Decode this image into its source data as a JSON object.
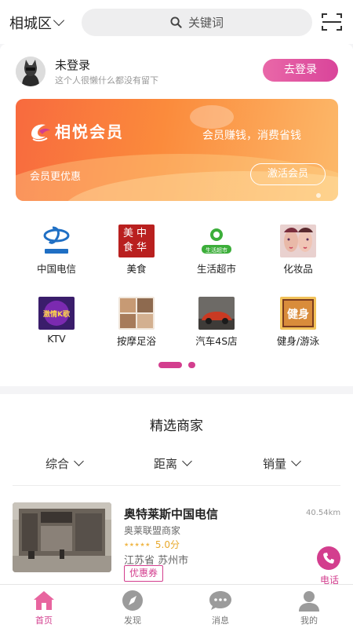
{
  "header": {
    "city": "相城区",
    "search_placeholder": "关键词"
  },
  "user": {
    "name": "未登录",
    "signature": "这个人很懒什么都没有留下",
    "login_label": "去登录"
  },
  "banner": {
    "brand": "相悦会员",
    "slogan": "会员赚钱，消费省钱",
    "subtitle": "会员更优惠",
    "action_label": "激活会员"
  },
  "categories": [
    {
      "label": "中国电信",
      "icon": "china-telecom-logo"
    },
    {
      "label": "美食",
      "icon": "food-sign",
      "sign_text": [
        "美中",
        "食华"
      ]
    },
    {
      "label": "生活超市",
      "icon": "supermarket-logo",
      "sign_text": "生活超市"
    },
    {
      "label": "化妆品",
      "icon": "cosmetics-photo"
    },
    {
      "label": "KTV",
      "icon": "ktv-sign",
      "sign_text": "激情K歌"
    },
    {
      "label": "按摩足浴",
      "icon": "massage-photo"
    },
    {
      "label": "汽车4S店",
      "icon": "car-photo"
    },
    {
      "label": "健身/游泳",
      "icon": "fitness-sign",
      "sign_text": "健身"
    }
  ],
  "category_pager": {
    "pages": 2,
    "current": 1
  },
  "merchants": {
    "title": "精选商家",
    "sort_options": [
      "综合",
      "距离",
      "销量"
    ],
    "items": [
      {
        "name": "奥特莱斯中国电信",
        "distance": "40.54km",
        "type": "奥莱联盟商家",
        "stars": "★★★★★",
        "rating": "5.0分",
        "address": "江苏省 苏州市",
        "coupon": "优惠券",
        "phone_label": "电话"
      }
    ]
  },
  "tabbar": {
    "items": [
      {
        "label": "首页",
        "icon": "home-icon",
        "active": true
      },
      {
        "label": "发现",
        "icon": "compass-icon",
        "active": false
      },
      {
        "label": "消息",
        "icon": "chat-icon",
        "active": false
      },
      {
        "label": "我的",
        "icon": "user-icon",
        "active": false
      }
    ]
  },
  "colors": {
    "accent": "#d33e8e",
    "banner_start": "#f86a3e",
    "banner_end": "#fcb96a"
  }
}
